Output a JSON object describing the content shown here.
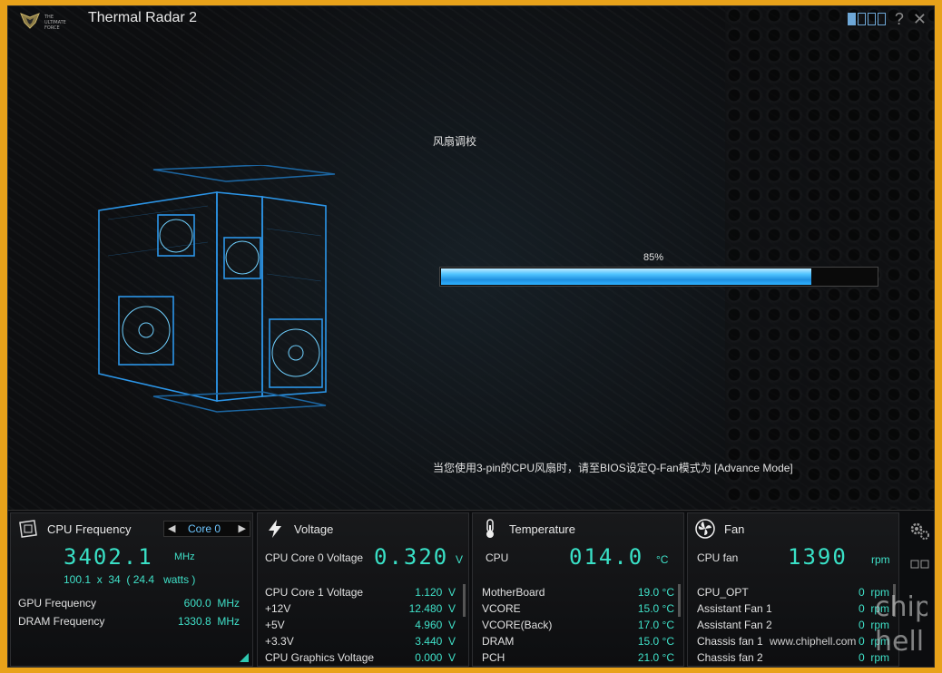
{
  "window": {
    "title": "Thermal Radar 2",
    "logo_text": "THE ULTIMATE FORCE",
    "help_label": "?",
    "close_label": "✕"
  },
  "calibration": {
    "title": "风扇调校",
    "progress_percent_label": "85%",
    "progress_fraction": 0.85,
    "notice": "当您使用3-pin的CPU风扇时，请至BIOS设定Q-Fan模式为 [Advance Mode]"
  },
  "cpu_frequency": {
    "title": "CPU Frequency",
    "core_select": "Core 0",
    "freq_value": "3402.1",
    "freq_unit": "MHz",
    "multiplier_line": "100.1  x  34  ( 24.4   watts )",
    "rows": [
      {
        "label": "GPU Frequency",
        "value": "600.0  MHz"
      },
      {
        "label": "DRAM Frequency",
        "value": "1330.8  MHz"
      }
    ]
  },
  "voltage": {
    "title": "Voltage",
    "main_label": "CPU Core 0 Voltage",
    "main_value": "0.320",
    "main_unit": "V",
    "rows": [
      {
        "label": "CPU Core 1 Voltage",
        "value": "1.120  V"
      },
      {
        "label": "+12V",
        "value": "12.480  V"
      },
      {
        "label": "+5V",
        "value": "4.960  V"
      },
      {
        "label": "+3.3V",
        "value": "3.440  V"
      },
      {
        "label": "CPU Graphics Voltage",
        "value": "0.000  V"
      }
    ]
  },
  "temperature": {
    "title": "Temperature",
    "main_label": "CPU",
    "main_value": "014.0",
    "main_unit": "°C",
    "rows": [
      {
        "label": "MotherBoard",
        "value": "19.0 °C"
      },
      {
        "label": "VCORE",
        "value": "15.0 °C"
      },
      {
        "label": "VCORE(Back)",
        "value": "17.0 °C"
      },
      {
        "label": "DRAM",
        "value": "15.0 °C"
      },
      {
        "label": "PCH",
        "value": "21.0 °C"
      }
    ]
  },
  "fan": {
    "title": "Fan",
    "main_label": "CPU fan",
    "main_value": "1390",
    "main_unit": "rpm",
    "rows": [
      {
        "label": "CPU_OPT",
        "value": "0  rpm"
      },
      {
        "label": "Assistant Fan 1",
        "value": "0  rpm"
      },
      {
        "label": "Assistant Fan 2",
        "value": "0  rpm"
      },
      {
        "label": "Chassis fan 1",
        "value": "0  rpm"
      },
      {
        "label": "Chassis fan 2",
        "value": "0  rpm"
      }
    ]
  },
  "watermark": {
    "text": "www.chiphell.com",
    "logo": "chip hell"
  }
}
